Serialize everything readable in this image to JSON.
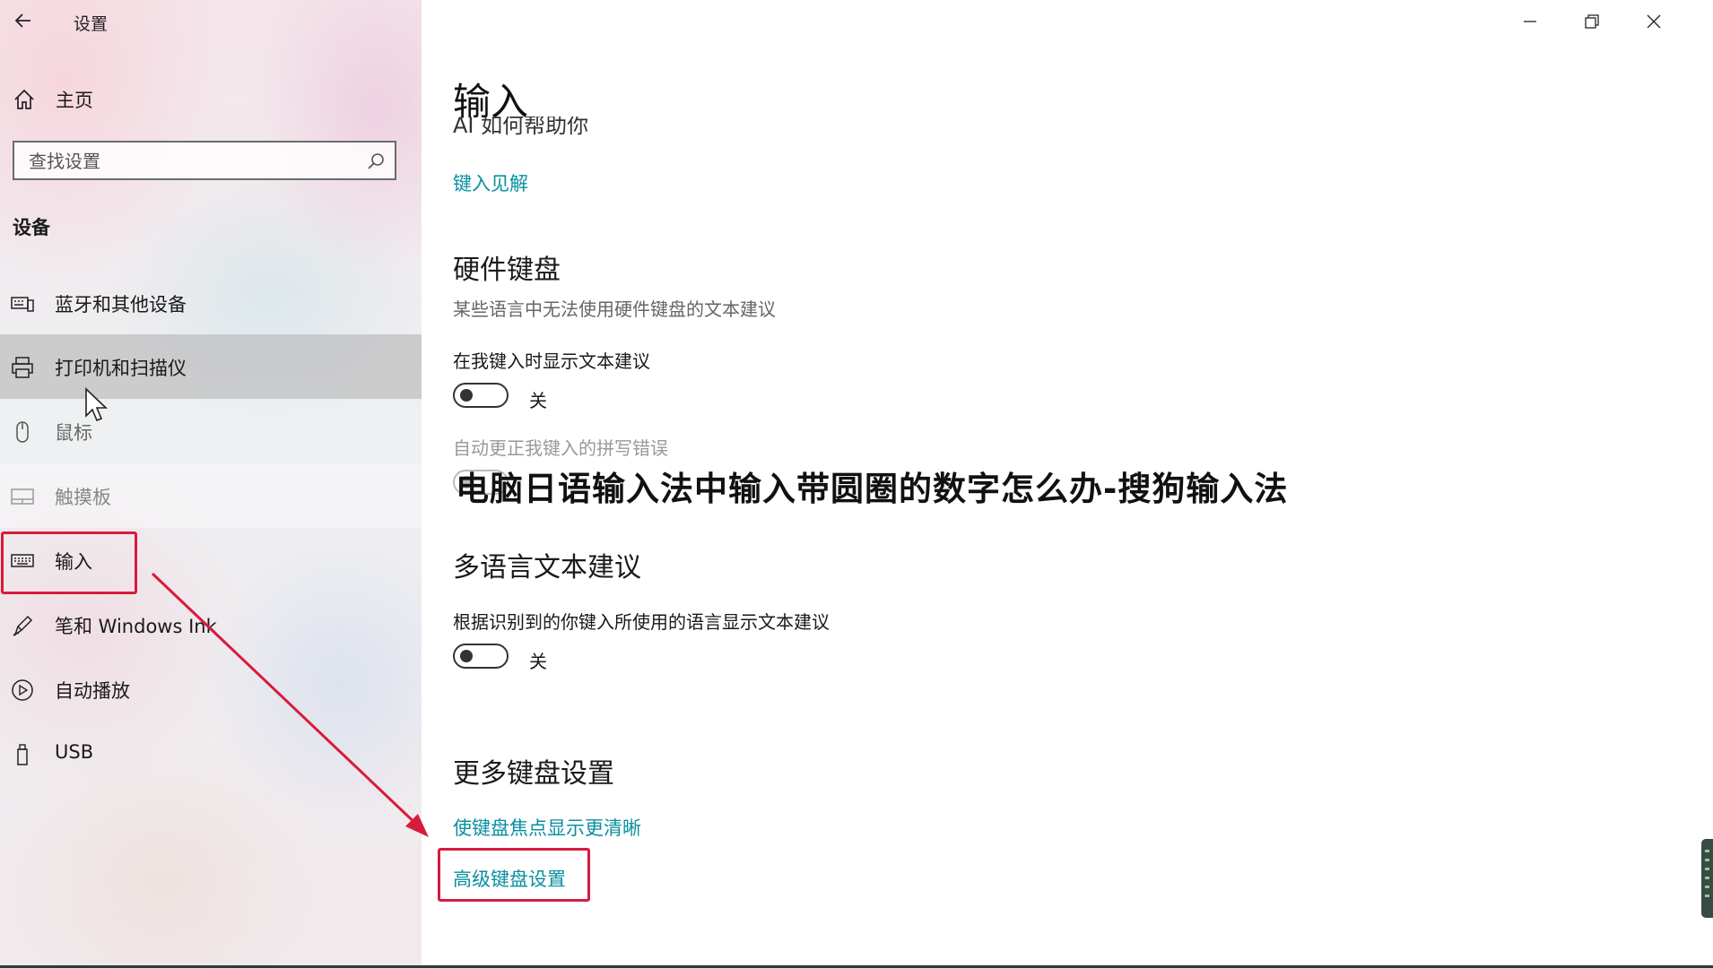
{
  "app": {
    "title": "设置"
  },
  "sidebar": {
    "home_label": "主页",
    "search_placeholder": "查找设置",
    "section": "设备",
    "items": [
      {
        "label": "蓝牙和其他设备",
        "icon": "bluetooth-devices-icon"
      },
      {
        "label": "打印机和扫描仪",
        "icon": "printer-icon"
      },
      {
        "label": "鼠标",
        "icon": "mouse-icon"
      },
      {
        "label": "触摸板",
        "icon": "touchpad-icon"
      },
      {
        "label": "输入",
        "icon": "keyboard-icon"
      },
      {
        "label": "笔和 Windows Ink",
        "icon": "pen-icon"
      },
      {
        "label": "自动播放",
        "icon": "autoplay-icon"
      },
      {
        "label": "USB",
        "icon": "usb-icon"
      }
    ]
  },
  "main": {
    "title": "输入",
    "clipped_heading": "AI 如何帮助你",
    "typing_insights_link": "键入见解",
    "hardware_keyboard": {
      "heading": "硬件键盘",
      "description": "某些语言中无法使用硬件键盘的文本建议",
      "show_suggestions_label": "在我键入时显示文本建议",
      "show_suggestions_state": "关",
      "autocorrect_label": "自动更正我键入的拼写错误"
    },
    "overlay_caption": "电脑日语输入法中输入带圆圈的数字怎么办-搜狗输入法",
    "multilingual": {
      "heading": "多语言文本建议",
      "label": "根据识别到的你键入所使用的语言显示文本建议",
      "state": "关"
    },
    "more_keyboard": {
      "heading": "更多键盘设置",
      "focus_link": "使键盘焦点显示更清晰",
      "advanced_link": "高级键盘设置"
    }
  },
  "colors": {
    "link": "#0a8fa0",
    "annotation_red": "#d81b3c"
  }
}
